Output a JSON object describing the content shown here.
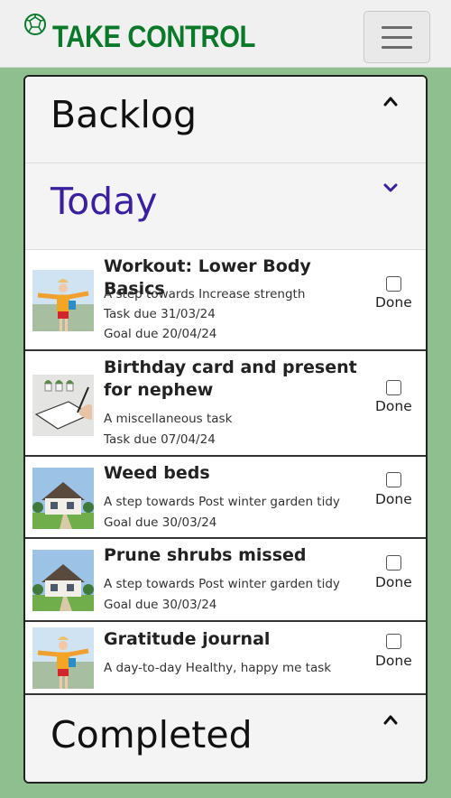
{
  "brand": {
    "name": "TAKE CONTROL",
    "color": "#0a7a2a",
    "icon": "soccer-ball-icon"
  },
  "nav": {
    "toggler_icon": "hamburger-icon"
  },
  "sections": {
    "backlog": {
      "title": "Backlog",
      "state": "collapsed"
    },
    "today": {
      "title": "Today",
      "state": "expanded",
      "color": "#3a1f9e"
    },
    "completed": {
      "title": "Completed",
      "state": "collapsed"
    }
  },
  "tasks": [
    {
      "title": "Workout: Lower Body Basics",
      "lines": [
        "A step towards Increase strength",
        "Task due 31/03/24",
        "Goal due 20/04/24"
      ],
      "image": "woman-hiking-photo",
      "done_label": "Done",
      "done": false
    },
    {
      "title": "Birthday card and present for nephew",
      "lines": [
        "A miscellaneous task",
        "Task due 07/04/24"
      ],
      "image": "writing-notebook-photo",
      "done_label": "Done",
      "done": false
    },
    {
      "title": "Weed beds",
      "lines": [
        "A step towards Post winter garden tidy",
        "Goal due 30/03/24"
      ],
      "image": "house-garden-photo",
      "done_label": "Done",
      "done": false
    },
    {
      "title": "Prune shrubs missed",
      "lines": [
        "A step towards Post winter garden tidy",
        "Goal due 30/03/24"
      ],
      "image": "house-garden-photo",
      "done_label": "Done",
      "done": false
    },
    {
      "title": "Gratitude journal",
      "lines": [
        "A day-to-day Healthy, happy me task"
      ],
      "image": "woman-hiking-photo",
      "done_label": "Done",
      "done": false
    }
  ]
}
